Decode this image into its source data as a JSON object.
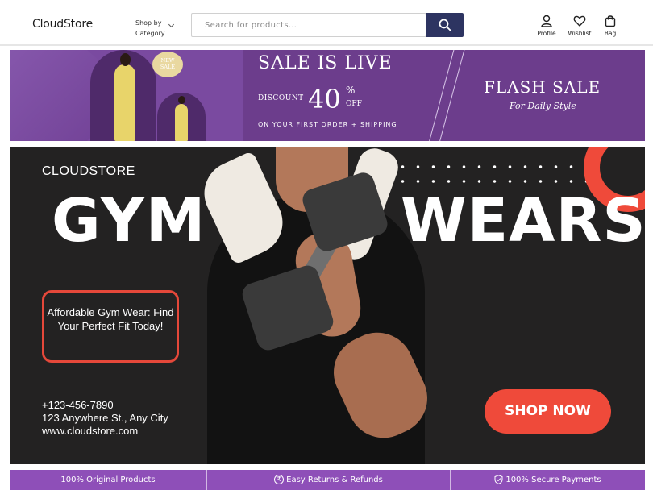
{
  "header": {
    "logo": "CloudStore",
    "shop_by_line1": "Shop by",
    "shop_by_line2": "Category",
    "search_placeholder": "Search for products...",
    "profile_label": "Profile",
    "wishlist_label": "Wishlist",
    "bag_label": "Bag"
  },
  "promo": {
    "badge_line1": "NEW",
    "badge_line2": "SALE",
    "sale_title": "SALE IS LIVE",
    "discount_label": "DISCOUNT",
    "discount_value": "40",
    "percent_sign": "%",
    "off_label": "OFF",
    "first_order": "ON YOUR FIRST ORDER + SHIPPING",
    "flash_sale": "FLASH SALE",
    "tagline": "For Daily Style"
  },
  "hero": {
    "brand": "CLOUDSTORE",
    "headline_left": "GYM",
    "headline_right": "WEARS",
    "callout": "Affordable Gym Wear: Find Your Perfect Fit Today!",
    "phone": "+123-456-7890",
    "address": "123 Anywhere St., Any City",
    "website": "www.cloudstore.com",
    "cta": "SHOP NOW"
  },
  "features": {
    "items": [
      {
        "label": "100% Original Products",
        "icon": ""
      },
      {
        "label": "Easy Returns & Refunds",
        "icon": "rupee-icon"
      },
      {
        "label": "100% Secure Payments",
        "icon": "shield-icon"
      }
    ]
  },
  "colors": {
    "search_button": "#2d3461",
    "promo_purple": "#6c3d8c",
    "hero_bg": "#232222",
    "accent_red": "#ef4a3a",
    "feature_bar": "#8e4fb8"
  }
}
